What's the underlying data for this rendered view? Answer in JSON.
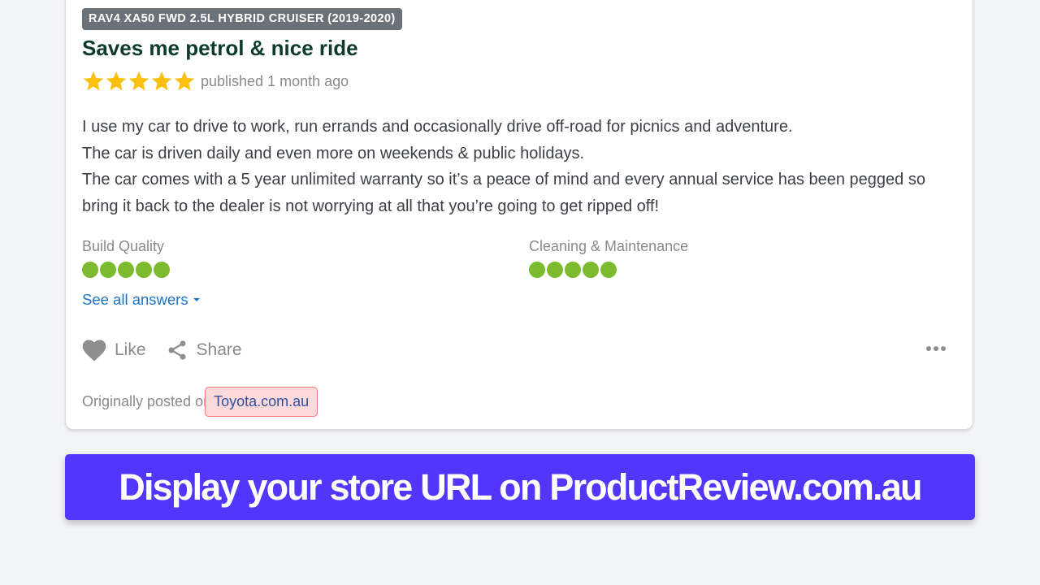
{
  "review": {
    "variant_badge": "RAV4 XA50 FWD 2.5L HYBRID CRUISER (2019-2020)",
    "title": "Saves me petrol & nice ride",
    "rating": 5,
    "rating_max": 5,
    "published": "published 1 month ago",
    "body": [
      "I use my car to drive to work, run errands and occasionally drive off-road for picnics and adventure.",
      "The car is driven daily and even more on weekends & public holidays.",
      "The car comes with a 5 year unlimited warranty so it’s a peace of mind and every annual service has been pegged so bring it back to the dealer is not worrying at all that you’re going to get ripped off!"
    ],
    "attributes": [
      {
        "label": "Build Quality",
        "score": 5,
        "max": 5
      },
      {
        "label": "Cleaning & Maintenance",
        "score": 5,
        "max": 5
      }
    ],
    "see_all_label": "See all answers",
    "actions": {
      "like_label": "Like",
      "share_label": "Share"
    },
    "origin": {
      "prefix": "Originally posted on",
      "link_label": "Toyota.com.au"
    }
  },
  "banner": {
    "text": "Display your store URL on ProductReview.com.au"
  },
  "colors": {
    "star": "#fbbf0f",
    "score_dot": "#7cbb2d",
    "banner_bg": "#5236fb",
    "title": "#0d3d2a",
    "link": "#1a73c8",
    "highlight_bg": "#fdd9db",
    "highlight_border": "#ef7a7d"
  }
}
